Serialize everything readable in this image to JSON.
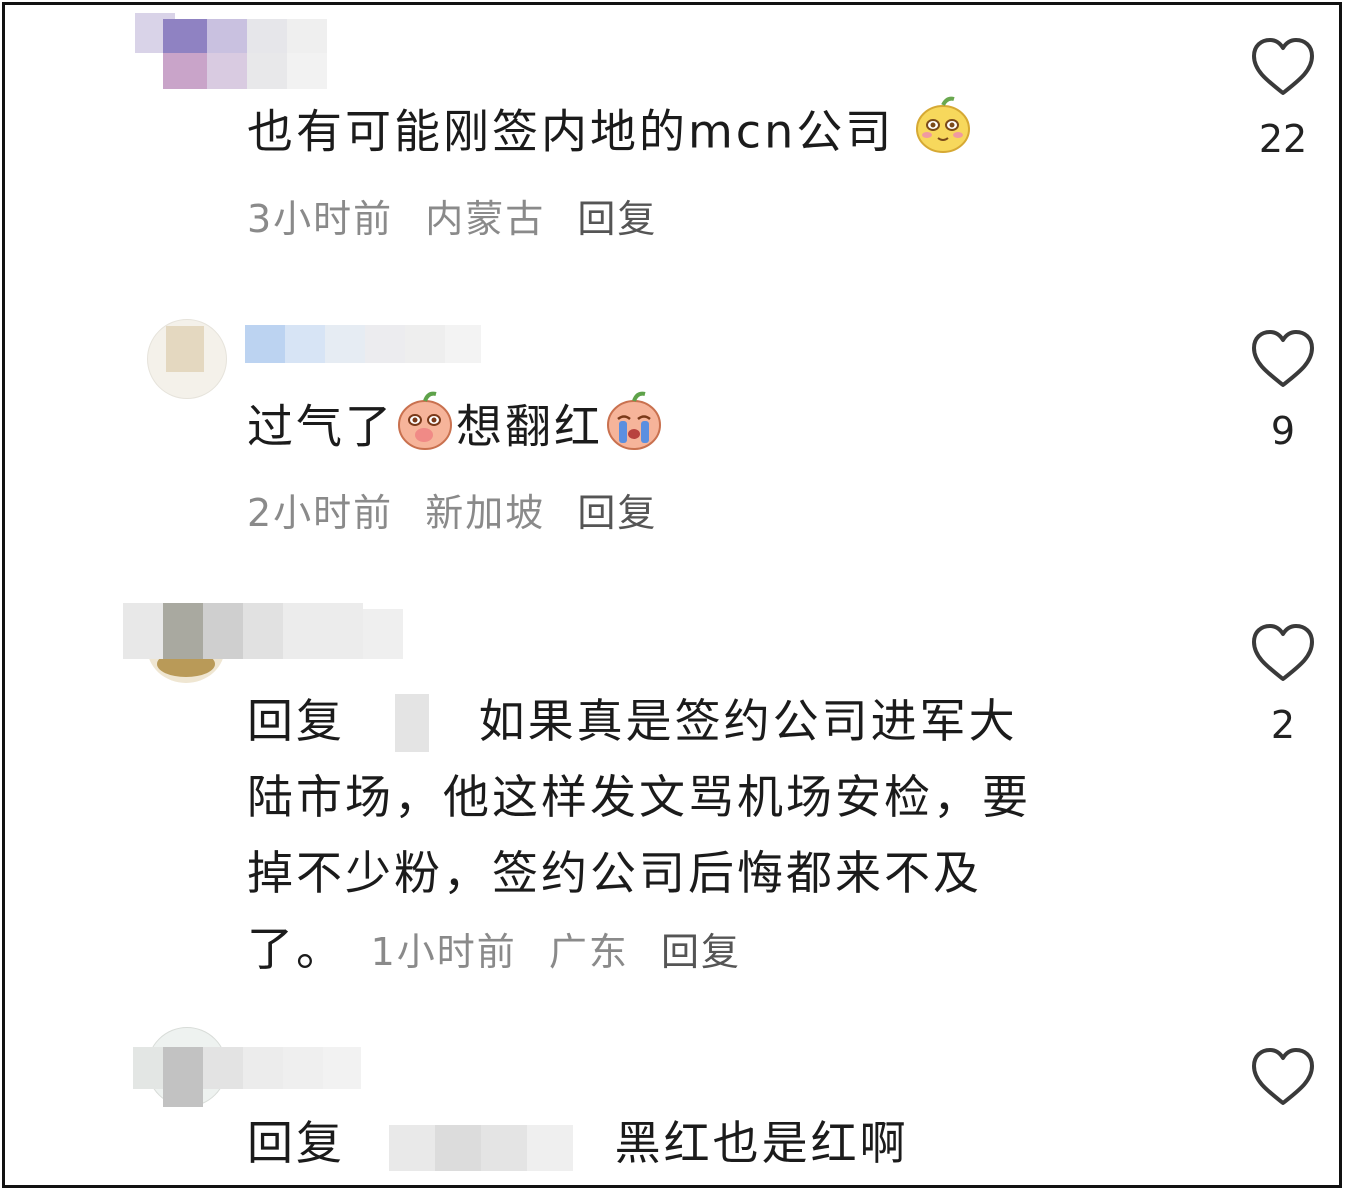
{
  "comments": [
    {
      "text": "也有可能刚签内地的mcn公司",
      "time": "3小时前",
      "location": "内蒙古",
      "reply_label": "回复",
      "likes": "22",
      "emoji": "shy-fruit-emoji"
    },
    {
      "text_a": "过气了",
      "text_b": "想翻红",
      "time": "2小时前",
      "location": "新加坡",
      "reply_label": "回复",
      "likes": "9",
      "emojis": [
        "face-palm-peach-emoji",
        "crying-peach-emoji"
      ]
    },
    {
      "reply_prefix": "回复",
      "line1": "如果真是签约公司进军大",
      "line2": "陆市场，他这样发文骂机场安检，要",
      "line3": "掉不少粉，签约公司后悔都来不及",
      "line4": "了。",
      "time": "1小时前",
      "location": "广东",
      "reply_label": "回复",
      "likes": "2"
    },
    {
      "reply_prefix": "回复",
      "text": "黑红也是红啊"
    }
  ],
  "icons": {
    "like": "heart-outline-icon"
  },
  "colors": {
    "text": "#1b1b1b",
    "meta": "#8a8a8a",
    "border": "#111111"
  }
}
